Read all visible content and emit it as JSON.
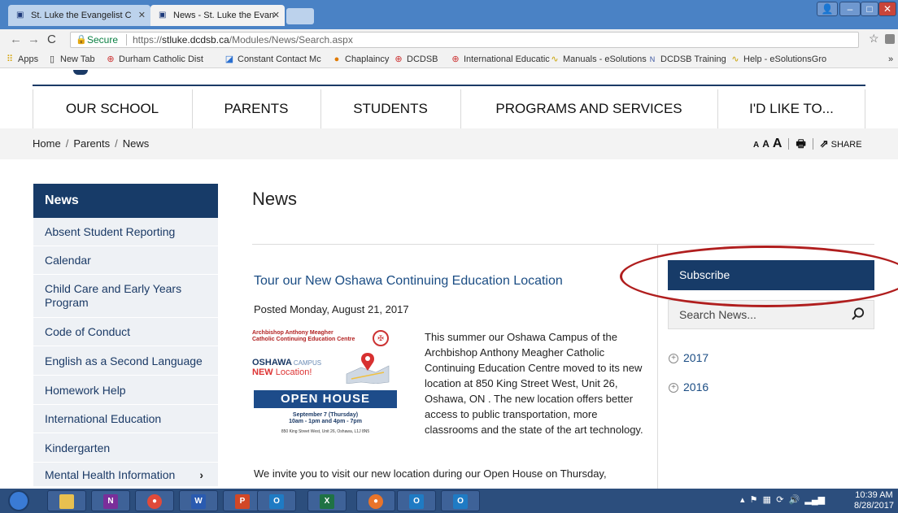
{
  "browser": {
    "tabs": [
      {
        "label": "St. Luke the Evangelist C",
        "active": false
      },
      {
        "label": "News - St. Luke the Evan",
        "active": true
      }
    ],
    "address": {
      "secure_label": "Secure",
      "url_scheme": "https://",
      "url_host": "stluke.dcdsb.ca",
      "url_path": "/Modules/News/Search.aspx"
    },
    "bookmarks": [
      {
        "label": "Apps",
        "icon": "apps-grid-icon"
      },
      {
        "label": "New Tab",
        "icon": "page-icon"
      },
      {
        "label": "Durham Catholic Dist",
        "icon": "dcdsb-icon"
      },
      {
        "label": "Constant Contact Mc",
        "icon": "constant-contact-icon"
      },
      {
        "label": "Chaplaincy",
        "icon": "chaplaincy-icon"
      },
      {
        "label": "DCDSB",
        "icon": "dcdsb-icon"
      },
      {
        "label": "International Educatic",
        "icon": "dcdsb-icon"
      },
      {
        "label": "Manuals - eSolutions",
        "icon": "esolutions-icon"
      },
      {
        "label": "DCDSB Training",
        "icon": "training-icon"
      },
      {
        "label": "Help - eSolutionsGro",
        "icon": "esolutions-icon"
      }
    ],
    "bookmarks_more": "»"
  },
  "site": {
    "nav": [
      "OUR SCHOOL",
      "PARENTS",
      "STUDENTS",
      "PROGRAMS AND SERVICES",
      "I'D LIKE TO..."
    ],
    "breadcrumb": [
      "Home",
      "Parents",
      "News"
    ],
    "tools": {
      "a_small": "A",
      "a_medium": "A",
      "a_large": "A",
      "share_label": "SHARE"
    },
    "leftnav": {
      "title": "News",
      "items": [
        {
          "label": "Absent Student Reporting",
          "has_children": false
        },
        {
          "label": "Calendar",
          "has_children": false
        },
        {
          "label": "Child Care and Early Years Program",
          "has_children": false
        },
        {
          "label": "Code of Conduct",
          "has_children": false
        },
        {
          "label": "English as a Second Language",
          "has_children": false
        },
        {
          "label": "Homework Help",
          "has_children": false
        },
        {
          "label": "International Education",
          "has_children": false
        },
        {
          "label": "Kindergarten",
          "has_children": false
        },
        {
          "label": "Mental Health Information",
          "has_children": true
        }
      ]
    },
    "page_title": "News",
    "article": {
      "title": "Tour our New Oshawa Continuing Education Location",
      "posted": "Posted Monday, August 21, 2017",
      "body": "This summer our Oshawa Campus of the Archbishop Anthony Meagher Catholic Continuing Education Centre moved to its new location at 850 King Street West, Unit 26, Oshawa, ON .  The new location offers better access to public transportation, more classrooms and the state of the art technology.",
      "body_more": "We invite you to visit our new location during our Open House on Thursday,",
      "flyer": {
        "line1": "Archbishop Anthony Meagher",
        "line2": "Catholic Continuing Education Centre",
        "oshawa": "OSHAWA",
        "campus": "CAMPUS",
        "new_word": "NEW",
        "location_word": "Location!",
        "open_house": "OPEN HOUSE",
        "date": "September 7 (Thursday)",
        "time": "10am - 1pm and 4pm - 7pm",
        "address": "850 King Street West, Unit 26, Oshawa, L1J 8N5"
      }
    },
    "sidebar": {
      "subscribe_label": "Subscribe",
      "search_placeholder": "Search News...",
      "years": [
        "2017",
        "2016"
      ]
    },
    "colors": {
      "navy": "#173b68",
      "link": "#1b4d84",
      "annotation": "#b01e1e"
    }
  },
  "taskbar": {
    "apps": [
      "file-explorer-icon",
      "onenote-icon",
      "chrome-icon",
      "word-icon",
      "powerpoint-icon",
      "outlook-icon",
      "excel-icon",
      "firefox-icon",
      "outlook-icon",
      "outlook-icon"
    ],
    "clock_time": "10:39 AM",
    "clock_date": "8/28/2017"
  }
}
